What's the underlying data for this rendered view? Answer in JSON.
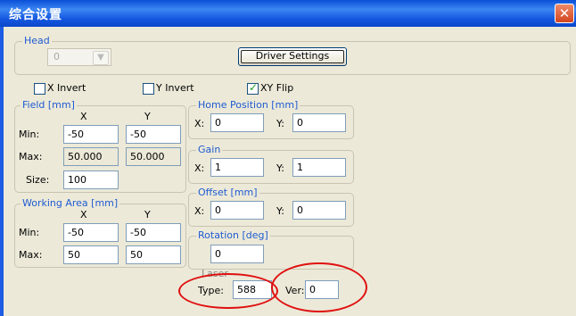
{
  "window": {
    "title": "综合设置",
    "close_label": "✕"
  },
  "head": {
    "legend": "Head",
    "selected": "0",
    "driver_settings_label": "Driver Settings"
  },
  "options": {
    "x_invert": {
      "label": "X Invert",
      "checked": false
    },
    "y_invert": {
      "label": "Y Invert",
      "checked": false
    },
    "xy_flip": {
      "label": "XY Flip",
      "checked": true
    }
  },
  "field": {
    "legend": "Field [mm]",
    "col_x": "X",
    "col_y": "Y",
    "min_label": "Min:",
    "min_x": "-50",
    "min_y": "-50",
    "max_label": "Max:",
    "max_x": "50.000",
    "max_y": "50.000",
    "size_label": "Size:",
    "size_value": "100"
  },
  "working_area": {
    "legend": "Working Area [mm]",
    "col_x": "X",
    "col_y": "Y",
    "min_label": "Min:",
    "min_x": "-50",
    "min_y": "-50",
    "max_label": "Max:",
    "max_x": "50",
    "max_y": "50"
  },
  "home_position": {
    "legend": "Home Position [mm]",
    "x_label": "X:",
    "x_value": "0",
    "y_label": "Y:",
    "y_value": "0"
  },
  "gain": {
    "legend": "Gain",
    "x_label": "X:",
    "x_value": "1",
    "y_label": "Y:",
    "y_value": "1"
  },
  "offset": {
    "legend": "Offset [mm]",
    "x_label": "X:",
    "x_value": "0",
    "y_label": "Y:",
    "y_value": "0"
  },
  "rotation": {
    "legend": "Rotation [deg]",
    "value": "0"
  },
  "laser": {
    "legend": "Laser",
    "type_label": "Type:",
    "type_value": "588",
    "ver_label": "Ver:",
    "ver_value": "0"
  },
  "colors": {
    "title_bar": "#1558e0",
    "legend_text": "#1f5bd3",
    "dialog_bg": "#ece9d8",
    "annotation": "#e01010"
  }
}
